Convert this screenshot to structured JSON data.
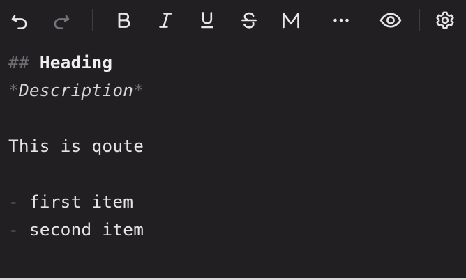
{
  "toolbar": {
    "undo_icon": "undo-icon",
    "redo_icon": "redo-icon",
    "bold_icon": "bold-icon",
    "italic_icon": "italic-icon",
    "underline_icon": "underline-icon",
    "strikethrough_icon": "strikethrough-icon",
    "markdown_icon": "markdown-icon",
    "more_icon": "more-icon",
    "preview_icon": "eye-icon",
    "settings_icon": "gear-icon"
  },
  "editor": {
    "lines": {
      "heading_marker": "##",
      "heading_text": "Heading",
      "description_open_marker": "*",
      "description_text": "Description",
      "description_close_marker": "*",
      "quote_text": "This is qoute",
      "list_marker_1": "-",
      "list_item_1": "first item",
      "list_marker_2": "-",
      "list_item_2": "second item"
    }
  },
  "colors": {
    "background": "#211f22",
    "text": "#e7e4e8",
    "markdown_syntax": "#6f6b73",
    "disabled_icon": "#77737a",
    "separator": "#3f3b42"
  }
}
